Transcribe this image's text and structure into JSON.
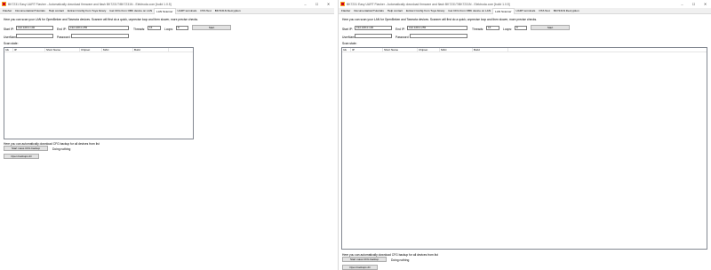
{
  "window": {
    "title": "BK7231 Easy UART Flasher - Automatically download firmware and flash BK7231T/BK7231N - Elektroda.com [build 1.0.5]",
    "controls": {
      "minimize": "–",
      "maximize": "☐",
      "close": "✕"
    }
  },
  "tabs": [
    {
      "label": "Flasher"
    },
    {
      "label": "Documentation/Tutorials"
    },
    {
      "label": "Help contact"
    },
    {
      "label": "Extract Config from Tuya binary"
    },
    {
      "label": "Get CFG from OBK device on LAN"
    },
    {
      "label": "LAN Scanner"
    },
    {
      "label": "UART terminals"
    },
    {
      "label": "OTA Test"
    },
    {
      "label": "BK7231N Decryption"
    }
  ],
  "active_tab_index": 5,
  "scanner": {
    "description": "Here you can scan your LAN for OpenBeken and Tasmota devices. Scanner will first do a quick, unprecise loop and then slower, more precise checks.",
    "start_ip_label": "Start IP:",
    "start_ip_value": "192.168.0.100",
    "end_ip_label": "End IP:",
    "end_ip_value": "192.168.0.255",
    "threads_label": "Threads:",
    "threads_value": "16",
    "loops_label": "Loops:",
    "loops_value": "8",
    "start_button": "Start",
    "username_label": "UserName:",
    "username_value": "",
    "password_label": "Password:",
    "password_value": "",
    "scan_state_label": "Scan state:",
    "columns": [
      "Idx",
      "IP",
      "Short Name",
      "Chipset",
      "MAC",
      "Build"
    ],
    "backup_note": "Here you can automatically download CFG backup for all devices from list",
    "mass_backup_button": "Start mass CFG backup",
    "status_text": "Doing nothing",
    "open_backups_button": "Open backups dir"
  }
}
